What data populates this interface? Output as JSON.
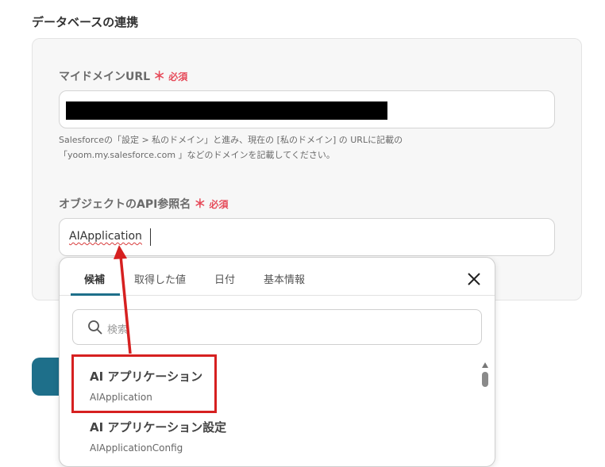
{
  "section": {
    "title": "データベースの連携"
  },
  "domain_field": {
    "label": "マイドメインURL",
    "required_mark": "＊",
    "required_label": "必須",
    "hint_line1": "Salesforceの「設定 > 私のドメイン」と進み、現在の [私のドメイン] の URLに記載の",
    "hint_line2": "「yoom.my.salesforce.com 」などのドメインを記載してください。"
  },
  "object_field": {
    "label": "オブジェクトのAPI参照名",
    "required_mark": "＊",
    "required_label": "必須",
    "value": "AIApplication"
  },
  "dropdown": {
    "tabs": [
      "候補",
      "取得した値",
      "日付",
      "基本情報"
    ],
    "active_tab": "候補",
    "search_placeholder": "検索",
    "options": [
      {
        "title": "AI アプリケーション",
        "subtitle": "AIApplication"
      },
      {
        "title": "AI アプリケーション設定",
        "subtitle": "AIApplicationConfig"
      }
    ]
  },
  "colors": {
    "accent": "#1e6f8a",
    "required": "#e64b5a",
    "annotation": "#d62020"
  }
}
